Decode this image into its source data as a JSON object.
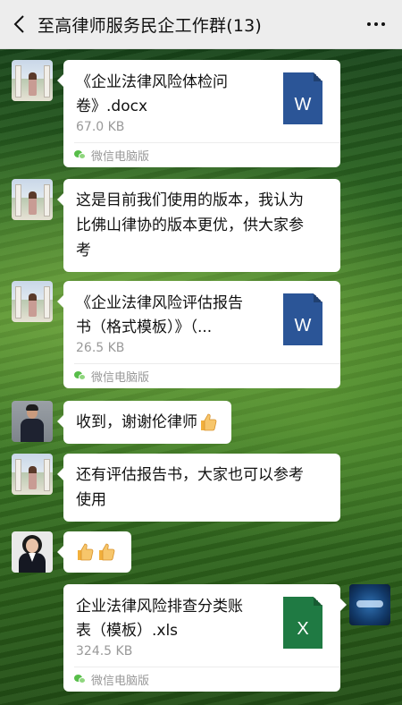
{
  "header": {
    "title": "至高律师服务民企工作群(13)"
  },
  "messages": [
    {
      "type": "file",
      "file_name": "《企业法律风险体检问卷》.docx",
      "file_name_lines": [
        "《企业法律风险体检问",
        "卷》.docx"
      ],
      "file_size": "67.0 KB",
      "file_kind": "word",
      "icon_label": "W",
      "source": "微信电脑版",
      "avatar": "landscape-avatar"
    },
    {
      "type": "text",
      "lines": [
        "这是目前我们使用的版本，我认为",
        "比佛山律协的版本更优，供大家参",
        "考"
      ],
      "avatar": "landscape-avatar"
    },
    {
      "type": "file",
      "file_name_lines": [
        "《企业法律风险评估报告",
        "书（格式模板）》（..."
      ],
      "file_size": "26.5 KB",
      "file_kind": "word",
      "icon_label": "W",
      "source": "微信电脑版",
      "avatar": "landscape-avatar"
    },
    {
      "type": "text",
      "lines": [
        "收到，谢谢伦律师"
      ],
      "emoji": "thumbs-up",
      "avatar": "man-avatar"
    },
    {
      "type": "text",
      "lines": [
        "还有评估报告书，大家也可以参考",
        "使用"
      ],
      "avatar": "landscape-avatar"
    },
    {
      "type": "emoji",
      "emojis": [
        "thumbs-up",
        "thumbs-up"
      ],
      "avatar": "woman-avatar"
    },
    {
      "type": "file",
      "side": "right",
      "file_name_lines": [
        "企业法律风险排查分类账",
        "表（模板）.xls"
      ],
      "file_size": "324.5 KB",
      "file_kind": "excel",
      "icon_label": "X",
      "source": "微信电脑版",
      "avatar": "tv-avatar"
    }
  ],
  "colors": {
    "header_bg": "#ededed",
    "word_blue": "#2b5597",
    "excel_green": "#1f7a43",
    "bubble_bg": "#ffffff"
  }
}
